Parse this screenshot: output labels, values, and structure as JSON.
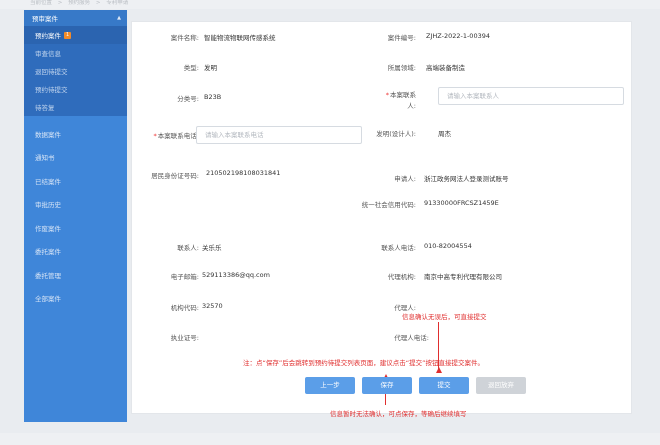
{
  "breadcrumb": [
    "当前位置",
    ">",
    "预约服务",
    ">",
    "专利申请"
  ],
  "sidebar": {
    "group_title": "预审案件",
    "sub_items": [
      {
        "label": "预约案件",
        "badge": "1"
      },
      {
        "label": "审查信息"
      },
      {
        "label": "退回待提交"
      },
      {
        "label": "预约待提交"
      },
      {
        "label": "待答复"
      }
    ],
    "main_items": [
      "数据案件",
      "通知书",
      "已结案件",
      "审批历史",
      "作废案件",
      "委托案件",
      "委托管理",
      "全部案件"
    ]
  },
  "form": {
    "case_name_label": "案件名称:",
    "case_name_value": "智能物流物联网传感系统",
    "case_no_label": "案件编号:",
    "case_no_value": "ZJHZ-2022-1-00394",
    "type_label": "类型:",
    "type_value": "发明",
    "field_label": "所属领域:",
    "field_value": "高端装备制造",
    "class_label": "分类号:",
    "class_value": "B23B",
    "contact_label_1": "本案联系",
    "contact_label_2": "人:",
    "contact_placeholder": "请输入本案联系人",
    "phone_label": "本案联系电话:",
    "phone_placeholder": "请输入本案联系电话",
    "inventor_label": "发明(设计人):",
    "inventor_value": "周杰",
    "id_label": "居民身份证号码:",
    "id_value": "210502198108031841",
    "applicant_label": "申请人:",
    "applicant_value": "浙江政务网法人登录测试账号",
    "credit_label": "统一社会信用代码:",
    "credit_value": "91330000FRCSZ1459E",
    "liaison_label": "联系人:",
    "liaison_value": "关乐乐",
    "liaison_phone_label": "联系人电话:",
    "liaison_phone_value": "010-82004554",
    "email_label": "电子邮箱:",
    "email_value": "529113386@qq.com",
    "agency_label": "代理机构:",
    "agency_value": "南京中高专利代理有限公司",
    "org_code_label": "机构代码:",
    "org_code_value": "32570",
    "agent_label": "代理人:",
    "cert_label": "执业证号:",
    "agent_phone_label": "代理人电话:"
  },
  "annotations": {
    "confirm_note": "信息确认无误后，可直接提交",
    "save_note": "注：点“保存”后会跳转到预约待提交列表页面，建议点击“提交”按钮直接提交案件。",
    "bottom_note": "信息暂时无法确认，可点保存，等确后继续填写"
  },
  "buttons": {
    "prev": "上一步",
    "save": "保存",
    "submit": "提交",
    "discard": "退回放弃"
  },
  "colors": {
    "sidebar": "#3f86d9",
    "button_blue": "#5b9ee8",
    "annotation_red": "#e02e2e"
  }
}
